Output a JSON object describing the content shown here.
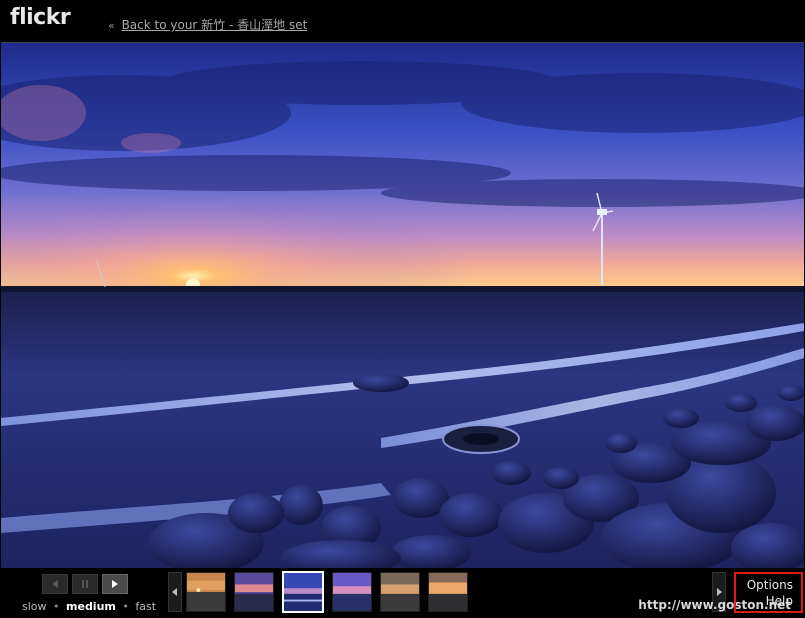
{
  "header": {
    "logo_text": "flickr",
    "logo_mark": "r",
    "back_arrow": "«",
    "back_link": "Back to your 新竹 - 香山溼地 set"
  },
  "photo": {
    "subject": "sunset-over-wetland-with-wind-turbine"
  },
  "controls": {
    "prev_icon": "prev-icon",
    "pause_icon": "pause-icon",
    "play_icon": "play-icon",
    "speeds": [
      "slow",
      "medium",
      "fast"
    ],
    "selected_speed": "medium"
  },
  "thumbnails": {
    "count": 6,
    "selected_index": 2
  },
  "watermark": "http://www.goston.net",
  "menu": {
    "options": "Options",
    "help": "Help"
  },
  "colors": {
    "highlight_box": "#e01818",
    "sky_top": "#2b3a9c",
    "sunset": "#ffb070"
  }
}
